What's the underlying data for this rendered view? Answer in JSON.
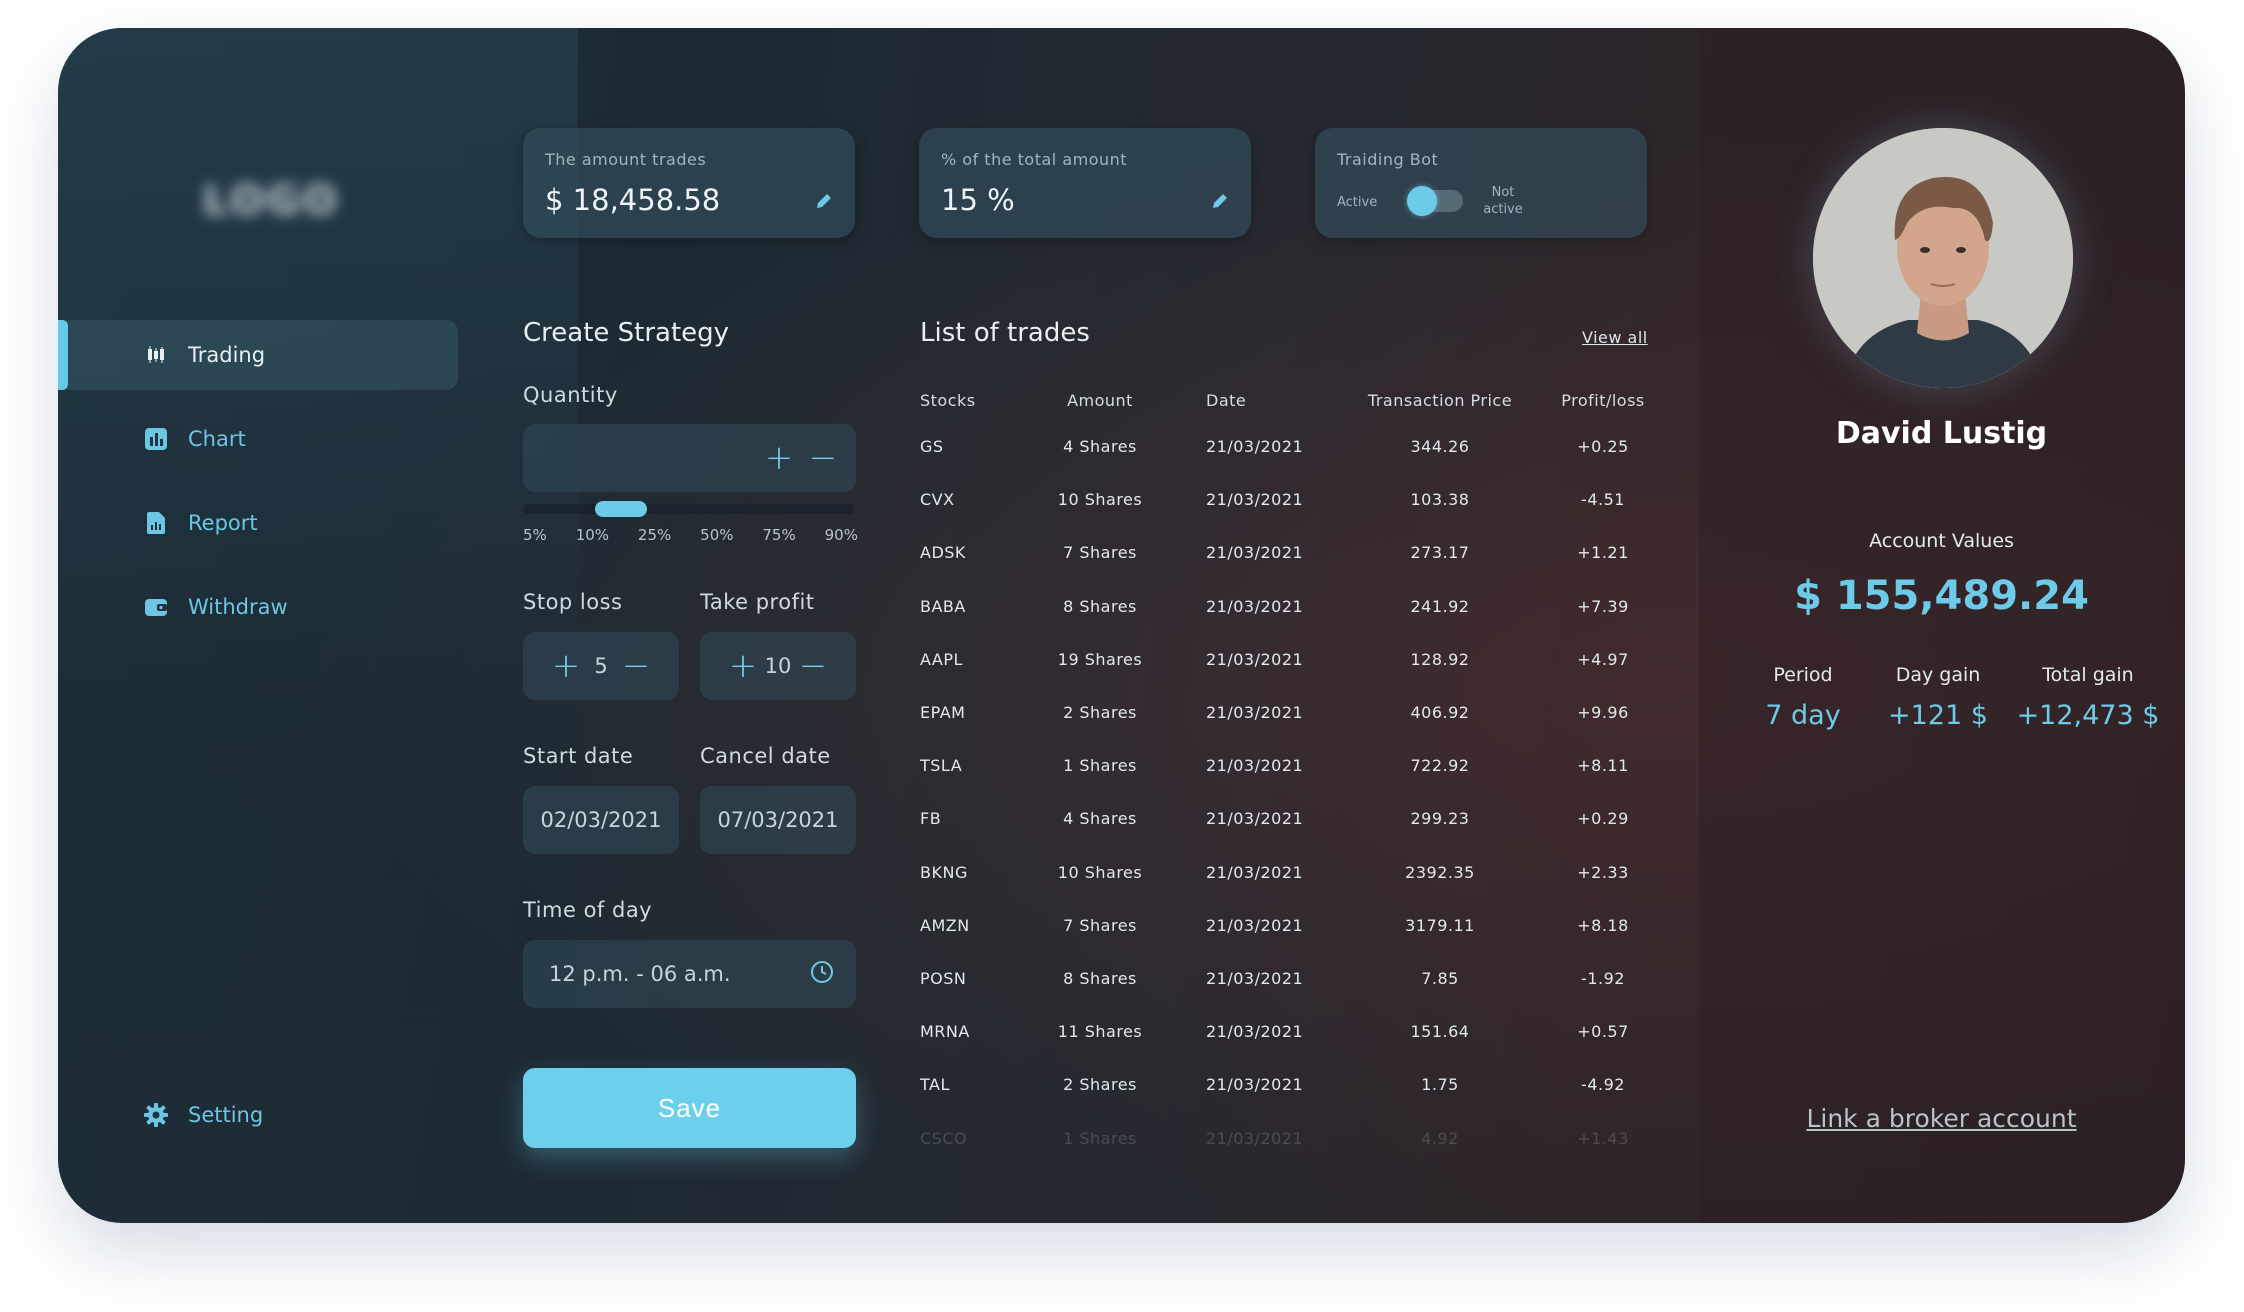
{
  "brand": {
    "logo": "LOGO"
  },
  "nav": {
    "items": [
      {
        "label": "Trading",
        "icon": "candlestick-icon"
      },
      {
        "label": "Chart",
        "icon": "bar-chart-icon"
      },
      {
        "label": "Report",
        "icon": "document-icon"
      },
      {
        "label": "Withdraw",
        "icon": "wallet-icon"
      }
    ],
    "setting": "Setting"
  },
  "cards": {
    "amount": {
      "label": "The amount trades",
      "value": "$ 18,458.58"
    },
    "percent": {
      "label": "% of the total amount",
      "value": "15 %"
    },
    "bot": {
      "label": "Traiding Bot",
      "active": "Active",
      "not_active_1": "Not",
      "not_active_2": "active",
      "state": "active"
    }
  },
  "strategy": {
    "title": "Create Strategy",
    "quantity_label": "Quantity",
    "slider_ticks": [
      "5%",
      "10%",
      "25%",
      "50%",
      "75%",
      "90%"
    ],
    "slider_value": "10%",
    "stop_loss_label": "Stop loss",
    "stop_loss_value": "5",
    "take_profit_label": "Take profit",
    "take_profit_value": "10",
    "start_date_label": "Start date",
    "start_date": "02/03/2021",
    "cancel_date_label": "Cancel date",
    "cancel_date": "07/03/2021",
    "time_label": "Time of day",
    "time_value": "12 p.m. - 06 a.m.",
    "save": "Save"
  },
  "trades": {
    "title": "List of trades",
    "view_all": "View all",
    "columns": [
      "Stocks",
      "Amount",
      "Date",
      "Transaction Price",
      "Profit/loss"
    ],
    "rows": [
      [
        "GS",
        "4 Shares",
        "21/03/2021",
        "344.26",
        "+0.25"
      ],
      [
        "CVX",
        "10 Shares",
        "21/03/2021",
        "103.38",
        "-4.51"
      ],
      [
        "ADSK",
        "7 Shares",
        "21/03/2021",
        "273.17",
        "+1.21"
      ],
      [
        "BABA",
        "8 Shares",
        "21/03/2021",
        "241.92",
        "+7.39"
      ],
      [
        "AAPL",
        "19 Shares",
        "21/03/2021",
        "128.92",
        "+4.97"
      ],
      [
        "EPAM",
        "2 Shares",
        "21/03/2021",
        "406.92",
        "+9.96"
      ],
      [
        "TSLA",
        "1 Shares",
        "21/03/2021",
        "722.92",
        "+8.11"
      ],
      [
        "FB",
        "4 Shares",
        "21/03/2021",
        "299.23",
        "+0.29"
      ],
      [
        "BKNG",
        "10 Shares",
        "21/03/2021",
        "2392.35",
        "+2.33"
      ],
      [
        "AMZN",
        "7 Shares",
        "21/03/2021",
        "3179.11",
        "+8.18"
      ],
      [
        "POSN",
        "8 Shares",
        "21/03/2021",
        "7.85",
        "-1.92"
      ],
      [
        "MRNA",
        "11 Shares",
        "21/03/2021",
        "151.64",
        "+0.57"
      ],
      [
        "TAL",
        "2 Shares",
        "21/03/2021",
        "1.75",
        "-4.92"
      ],
      [
        "CSCO",
        "1 Shares",
        "21/03/2021",
        "4.92",
        "+1.43"
      ]
    ]
  },
  "profile": {
    "name": "David Lustig",
    "account_label": "Account Values",
    "account_value": "$ 155,489.24",
    "period_label": "Period",
    "period_value": "7 day",
    "day_gain_label": "Day gain",
    "day_gain_value": "+121 $",
    "total_gain_label": "Total gain",
    "total_gain_value": "+12,473 $",
    "broker_link": "Link a broker account"
  },
  "colors": {
    "accent": "#6ccbe8",
    "profit": "#4cc27a",
    "loss": "#e2574c"
  }
}
